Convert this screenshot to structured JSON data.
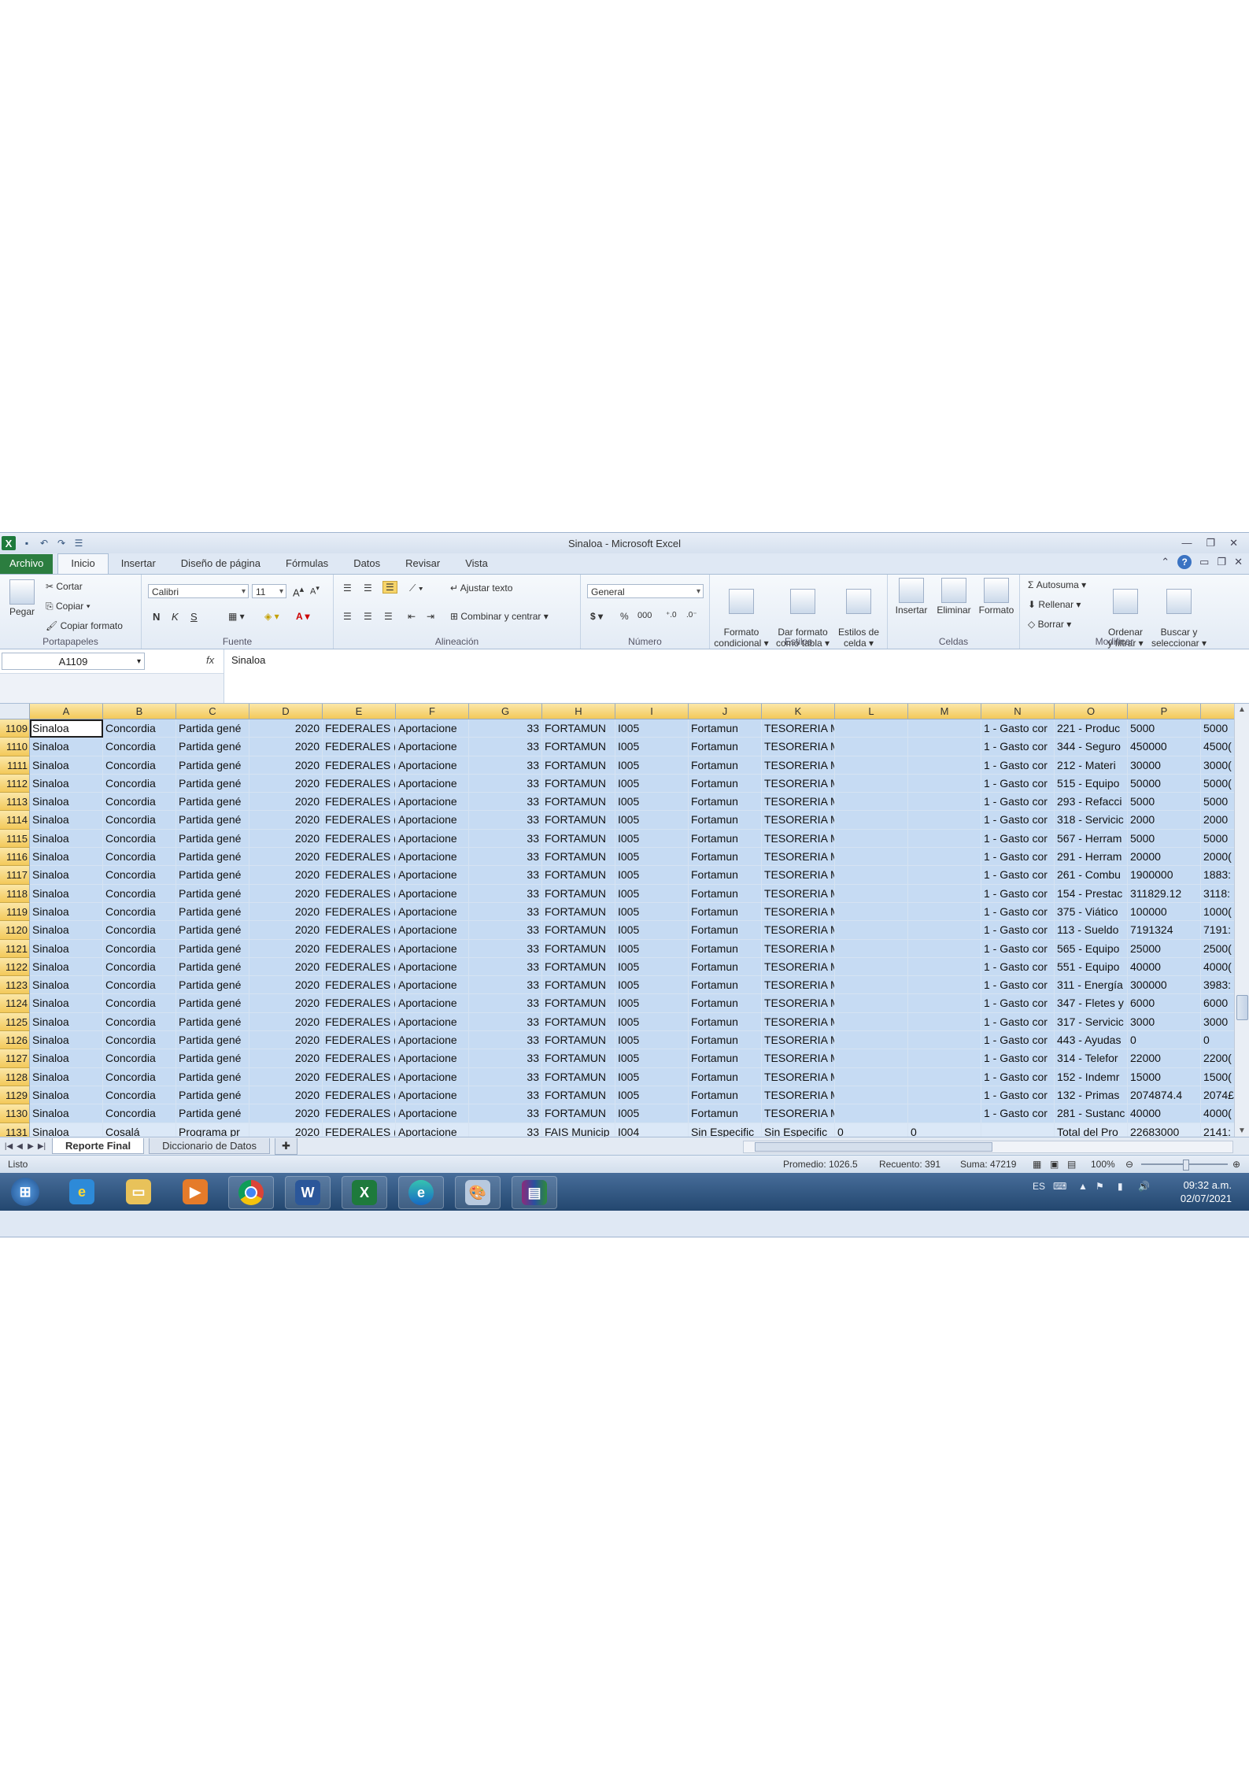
{
  "window": {
    "title": "Sinaloa  -  Microsoft Excel",
    "controls": [
      "—",
      "❐",
      "✕"
    ]
  },
  "tabs": {
    "file": "Archivo",
    "items": [
      "Inicio",
      "Insertar",
      "Diseño de página",
      "Fórmulas",
      "Datos",
      "Revisar",
      "Vista"
    ]
  },
  "ribbon": {
    "portapapeles": {
      "label": "Portapapeles",
      "paste": "Pegar",
      "cut": "Cortar",
      "copy": "Copiar ▾",
      "format_painter": "Copiar formato"
    },
    "fuente": {
      "label": "Fuente",
      "font": "Calibri",
      "size": "11",
      "bold": "N",
      "italic": "K",
      "underline": "S"
    },
    "alineacion": {
      "label": "Alineación",
      "wrap": "Ajustar texto",
      "merge": "Combinar y centrar ▾"
    },
    "numero": {
      "label": "Número",
      "format": "General",
      "currency": "$ ▾",
      "percent": "%",
      "thousands": "000"
    },
    "estilos": {
      "label": "Estilos",
      "cond": "Formato\ncondicional ▾",
      "table": "Dar formato\ncomo tabla ▾",
      "cell": "Estilos de\ncelda ▾"
    },
    "celdas": {
      "label": "Celdas",
      "insert": "Insertar",
      "delete": "Eliminar",
      "format": "Formato"
    },
    "modificar": {
      "label": "Modificar",
      "autosum": "Autosuma ▾",
      "fill": "Rellenar ▾",
      "clear": "Borrar ▾",
      "sort": "Ordenar\ny filtrar ▾",
      "find": "Buscar y\nseleccionar ▾"
    }
  },
  "formula_bar": {
    "name_box": "A1109",
    "fx": "fx",
    "value": "Sinaloa"
  },
  "columns": [
    "A",
    "B",
    "C",
    "D",
    "E",
    "F",
    "G",
    "H",
    "I",
    "J",
    "K",
    "L",
    "M",
    "N",
    "O",
    "P",
    ""
  ],
  "rows": [
    {
      "n": "1109",
      "c": [
        "Sinaloa",
        "Concordia",
        "Partida gené",
        "2020",
        "FEDERALES (",
        "Aportacione",
        "33",
        "FORTAMUN",
        "I005",
        "Fortamun",
        "TESORERIA M",
        "",
        "",
        "1 - Gasto cor",
        "221 - Produc",
        "5000",
        "5000"
      ]
    },
    {
      "n": "1110",
      "c": [
        "Sinaloa",
        "Concordia",
        "Partida gené",
        "2020",
        "FEDERALES (",
        "Aportacione",
        "33",
        "FORTAMUN",
        "I005",
        "Fortamun",
        "TESORERIA M",
        "",
        "",
        "1 - Gasto cor",
        "344 - Seguro",
        "450000",
        "4500("
      ]
    },
    {
      "n": "1111",
      "c": [
        "Sinaloa",
        "Concordia",
        "Partida gené",
        "2020",
        "FEDERALES (",
        "Aportacione",
        "33",
        "FORTAMUN",
        "I005",
        "Fortamun",
        "TESORERIA M",
        "",
        "",
        "1 - Gasto cor",
        "212 - Materi",
        "30000",
        "3000("
      ]
    },
    {
      "n": "1112",
      "c": [
        "Sinaloa",
        "Concordia",
        "Partida gené",
        "2020",
        "FEDERALES (",
        "Aportacione",
        "33",
        "FORTAMUN",
        "I005",
        "Fortamun",
        "TESORERIA M",
        "",
        "",
        "1 - Gasto cor",
        "515 - Equipo",
        "50000",
        "5000("
      ]
    },
    {
      "n": "1113",
      "c": [
        "Sinaloa",
        "Concordia",
        "Partida gené",
        "2020",
        "FEDERALES (",
        "Aportacione",
        "33",
        "FORTAMUN",
        "I005",
        "Fortamun",
        "TESORERIA M",
        "",
        "",
        "1 - Gasto cor",
        "293 - Refacci",
        "5000",
        "5000"
      ]
    },
    {
      "n": "1114",
      "c": [
        "Sinaloa",
        "Concordia",
        "Partida gené",
        "2020",
        "FEDERALES (",
        "Aportacione",
        "33",
        "FORTAMUN",
        "I005",
        "Fortamun",
        "TESORERIA M",
        "",
        "",
        "1 - Gasto cor",
        "318 - Servicic",
        "2000",
        "2000"
      ]
    },
    {
      "n": "1115",
      "c": [
        "Sinaloa",
        "Concordia",
        "Partida gené",
        "2020",
        "FEDERALES (",
        "Aportacione",
        "33",
        "FORTAMUN",
        "I005",
        "Fortamun",
        "TESORERIA M",
        "",
        "",
        "1 - Gasto cor",
        "567 - Herram",
        "5000",
        "5000"
      ]
    },
    {
      "n": "1116",
      "c": [
        "Sinaloa",
        "Concordia",
        "Partida gené",
        "2020",
        "FEDERALES (",
        "Aportacione",
        "33",
        "FORTAMUN",
        "I005",
        "Fortamun",
        "TESORERIA M",
        "",
        "",
        "1 - Gasto cor",
        "291 - Herram",
        "20000",
        "2000("
      ]
    },
    {
      "n": "1117",
      "c": [
        "Sinaloa",
        "Concordia",
        "Partida gené",
        "2020",
        "FEDERALES (",
        "Aportacione",
        "33",
        "FORTAMUN",
        "I005",
        "Fortamun",
        "TESORERIA M",
        "",
        "",
        "1 - Gasto cor",
        "261 - Combu",
        "1900000",
        "1883:"
      ]
    },
    {
      "n": "1118",
      "c": [
        "Sinaloa",
        "Concordia",
        "Partida gené",
        "2020",
        "FEDERALES (",
        "Aportacione",
        "33",
        "FORTAMUN",
        "I005",
        "Fortamun",
        "TESORERIA M",
        "",
        "",
        "1 - Gasto cor",
        "154 - Prestac",
        "311829.12",
        "3118:"
      ]
    },
    {
      "n": "1119",
      "c": [
        "Sinaloa",
        "Concordia",
        "Partida gené",
        "2020",
        "FEDERALES (",
        "Aportacione",
        "33",
        "FORTAMUN",
        "I005",
        "Fortamun",
        "TESORERIA M",
        "",
        "",
        "1 - Gasto cor",
        "375 - Viático",
        "100000",
        "1000("
      ]
    },
    {
      "n": "1120",
      "c": [
        "Sinaloa",
        "Concordia",
        "Partida gené",
        "2020",
        "FEDERALES (",
        "Aportacione",
        "33",
        "FORTAMUN",
        "I005",
        "Fortamun",
        "TESORERIA M",
        "",
        "",
        "1 - Gasto cor",
        "113 - Sueldo",
        "7191324",
        "7191:"
      ]
    },
    {
      "n": "1121",
      "c": [
        "Sinaloa",
        "Concordia",
        "Partida gené",
        "2020",
        "FEDERALES (",
        "Aportacione",
        "33",
        "FORTAMUN",
        "I005",
        "Fortamun",
        "TESORERIA M",
        "",
        "",
        "1 - Gasto cor",
        "565 - Equipo",
        "25000",
        "2500("
      ]
    },
    {
      "n": "1122",
      "c": [
        "Sinaloa",
        "Concordia",
        "Partida gené",
        "2020",
        "FEDERALES (",
        "Aportacione",
        "33",
        "FORTAMUN",
        "I005",
        "Fortamun",
        "TESORERIA M",
        "",
        "",
        "1 - Gasto cor",
        "551 - Equipo",
        "40000",
        "4000("
      ]
    },
    {
      "n": "1123",
      "c": [
        "Sinaloa",
        "Concordia",
        "Partida gené",
        "2020",
        "FEDERALES (",
        "Aportacione",
        "33",
        "FORTAMUN",
        "I005",
        "Fortamun",
        "TESORERIA M",
        "",
        "",
        "1 - Gasto cor",
        "311 - Energía",
        "300000",
        "3983:"
      ]
    },
    {
      "n": "1124",
      "c": [
        "Sinaloa",
        "Concordia",
        "Partida gené",
        "2020",
        "FEDERALES (",
        "Aportacione",
        "33",
        "FORTAMUN",
        "I005",
        "Fortamun",
        "TESORERIA M",
        "",
        "",
        "1 - Gasto cor",
        "347 - Fletes y",
        "6000",
        "6000"
      ]
    },
    {
      "n": "1125",
      "c": [
        "Sinaloa",
        "Concordia",
        "Partida gené",
        "2020",
        "FEDERALES (",
        "Aportacione",
        "33",
        "FORTAMUN",
        "I005",
        "Fortamun",
        "TESORERIA M",
        "",
        "",
        "1 - Gasto cor",
        "317 - Servicic",
        "3000",
        "3000"
      ]
    },
    {
      "n": "1126",
      "c": [
        "Sinaloa",
        "Concordia",
        "Partida gené",
        "2020",
        "FEDERALES (",
        "Aportacione",
        "33",
        "FORTAMUN",
        "I005",
        "Fortamun",
        "TESORERIA M",
        "",
        "",
        "1 - Gasto cor",
        "443 - Ayudas",
        "0",
        "0"
      ]
    },
    {
      "n": "1127",
      "c": [
        "Sinaloa",
        "Concordia",
        "Partida gené",
        "2020",
        "FEDERALES (",
        "Aportacione",
        "33",
        "FORTAMUN",
        "I005",
        "Fortamun",
        "TESORERIA M",
        "",
        "",
        "1 - Gasto cor",
        "314 - Telefor",
        "22000",
        "2200("
      ]
    },
    {
      "n": "1128",
      "c": [
        "Sinaloa",
        "Concordia",
        "Partida gené",
        "2020",
        "FEDERALES (",
        "Aportacione",
        "33",
        "FORTAMUN",
        "I005",
        "Fortamun",
        "TESORERIA M",
        "",
        "",
        "1 - Gasto cor",
        "152 - Indemr",
        "15000",
        "1500("
      ]
    },
    {
      "n": "1129",
      "c": [
        "Sinaloa",
        "Concordia",
        "Partida gené",
        "2020",
        "FEDERALES (",
        "Aportacione",
        "33",
        "FORTAMUN",
        "I005",
        "Fortamun",
        "TESORERIA M",
        "",
        "",
        "1 - Gasto cor",
        "132 - Primas",
        "2074874.4",
        "2074£"
      ]
    },
    {
      "n": "1130",
      "c": [
        "Sinaloa",
        "Concordia",
        "Partida gené",
        "2020",
        "FEDERALES (",
        "Aportacione",
        "33",
        "FORTAMUN",
        "I005",
        "Fortamun",
        "TESORERIA M",
        "",
        "",
        "1 - Gasto cor",
        "281 - Sustanc",
        "40000",
        "4000("
      ]
    },
    {
      "n": "1131",
      "c": [
        "Sinaloa",
        "Cosalá",
        "Programa pr",
        "2020",
        "FEDERALES (",
        "Aportacione",
        "33",
        "FAIS Municip",
        "I004",
        "Sin Especific",
        "Sin Especific",
        "0",
        "0",
        "",
        "Total del Pro",
        "22683000",
        "2141:"
      ]
    }
  ],
  "sheet_tabs": [
    "Reporte Final",
    "Diccionario de Datos"
  ],
  "status": {
    "ready": "Listo",
    "average": "Promedio: 1026.5",
    "count": "Recuento: 391",
    "sum": "Suma: 47219",
    "zoom": "100%"
  },
  "taskbar": {
    "language": "ES",
    "time": "09:32 a.m.",
    "date": "02/07/2021"
  },
  "colors": {
    "selection": "#c6dbf3",
    "header_selected": "#f3c95a",
    "file_tab": "#2b7d3f",
    "taskbar": "#23476f"
  }
}
